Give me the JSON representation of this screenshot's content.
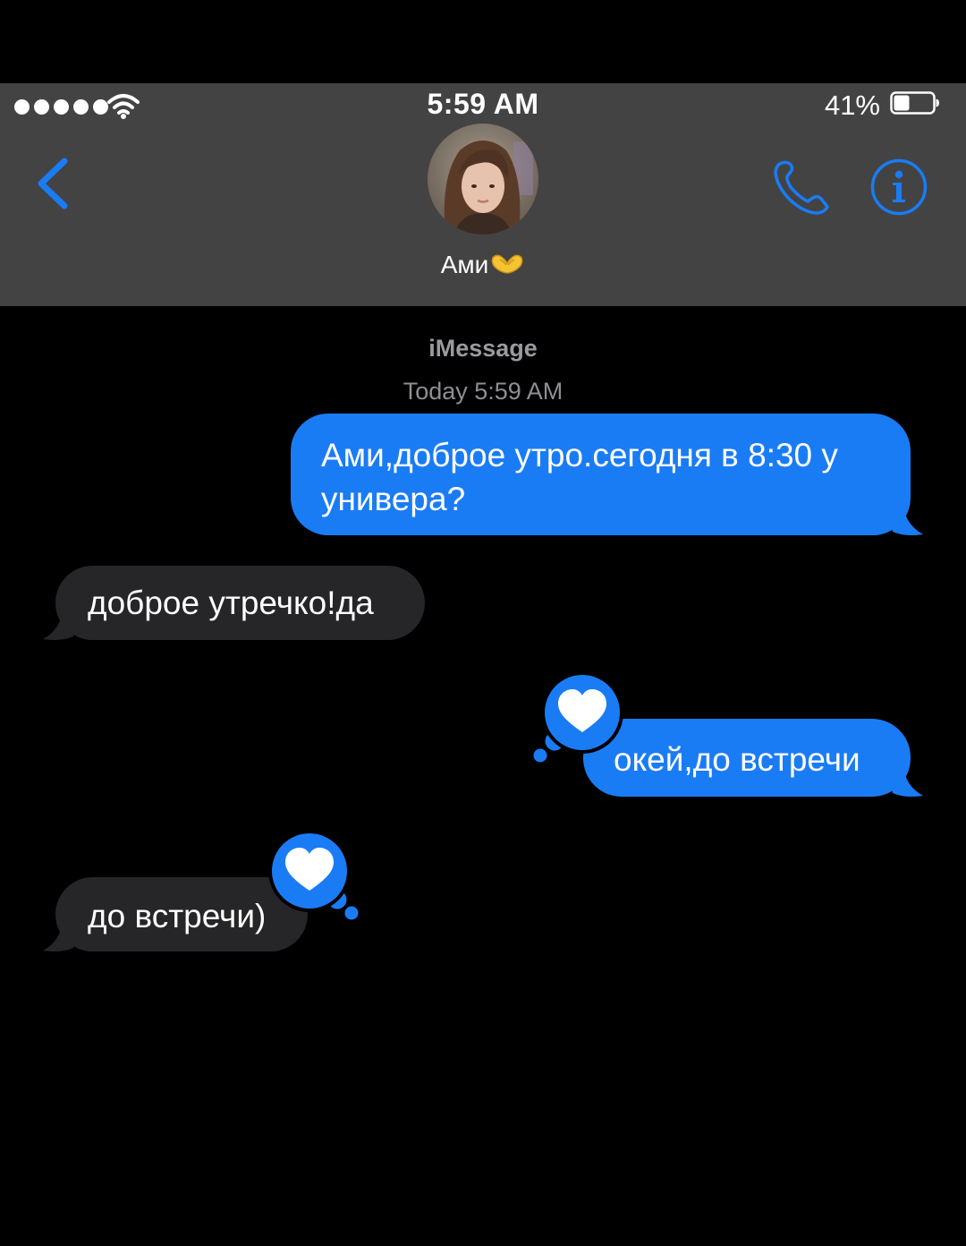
{
  "status_bar": {
    "time": "5:59 AM",
    "battery_percent": "41%",
    "battery_level": 0.41,
    "signal_dots": 5
  },
  "header": {
    "contact_name": "Ами",
    "contact_emoji": "heart-hands-emoji",
    "back_icon": "chevron-left-icon",
    "call_icon": "phone-icon",
    "info_icon": "info-icon"
  },
  "thread": {
    "service": "iMessage",
    "timestamp": "Today 5:59 AM",
    "messages": [
      {
        "direction": "outgoing",
        "text": "Ами,доброе утро.сегодня в 8:30 у универа?"
      },
      {
        "direction": "incoming",
        "text": "доброе утречко!да"
      },
      {
        "direction": "outgoing",
        "text": "окей,до встречи",
        "reaction": "heart"
      },
      {
        "direction": "incoming",
        "text": "до встречи)",
        "reaction": "heart"
      }
    ]
  },
  "colors": {
    "accent_blue": "#1a7cf5",
    "header_bg": "#434343",
    "incoming_bubble": "#262628",
    "background": "#000000"
  }
}
